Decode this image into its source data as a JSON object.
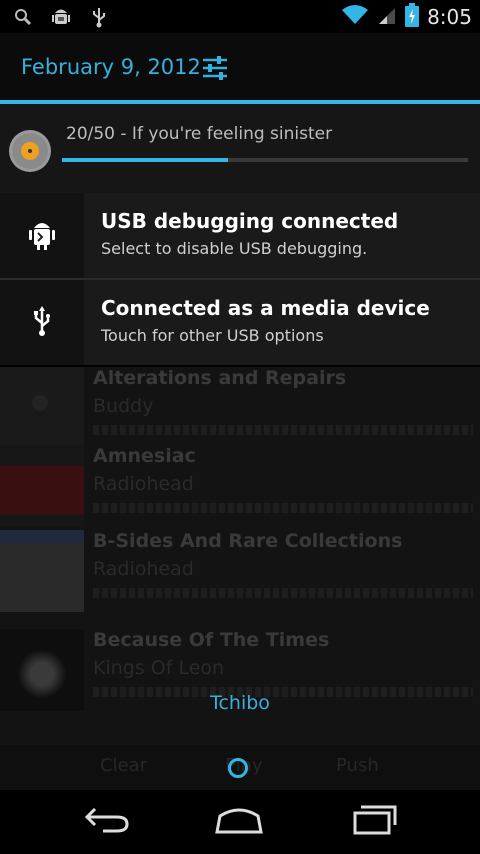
{
  "status_bar": {
    "icons_left": [
      "search-icon",
      "android-debug-icon",
      "usb-icon"
    ],
    "icons_right": [
      "wifi-icon",
      "signal-icon",
      "battery-charging-icon"
    ],
    "time": "8:05"
  },
  "header": {
    "date": "February 9, 2012",
    "settings_icon": "quick-settings-icon"
  },
  "music_notification": {
    "track": "20/50 - If you're feeling sinister",
    "progress_fraction": 0.41
  },
  "notifications": [
    {
      "title": "USB debugging connected",
      "subtitle": "Select to disable USB debugging.",
      "icon": "android-debug-icon"
    },
    {
      "title": "Connected as a media device",
      "subtitle": "Touch for other USB options",
      "icon": "usb-icon"
    }
  ],
  "background_list": [
    {
      "title": "Alterations and Repairs",
      "artist": "Buddy"
    },
    {
      "title": "Amnesiac",
      "artist": "Radiohead"
    },
    {
      "title": "B-Sides And Rare Collections",
      "artist": "Radiohead"
    },
    {
      "title": "Because Of The Times",
      "artist": "Kings Of Leon"
    }
  ],
  "toast": "Tchibo",
  "bottom_tabs": [
    "Clear",
    "Play",
    "Push"
  ],
  "colors": {
    "accent": "#33b5e5"
  }
}
